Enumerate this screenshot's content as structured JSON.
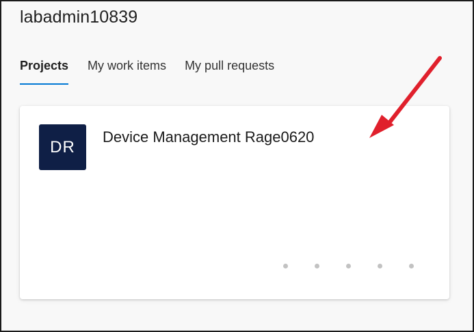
{
  "header": {
    "username": "labadmin10839"
  },
  "tabs": [
    {
      "label": "Projects",
      "selected": true
    },
    {
      "label": "My work items",
      "selected": false
    },
    {
      "label": "My pull requests",
      "selected": false
    }
  ],
  "project_card": {
    "avatar_initials": "DR",
    "name": "Device Management Rage0620",
    "pager_dots": 5
  },
  "colors": {
    "accent": "#0078d4",
    "avatar_bg": "#0f1f46",
    "annotation_arrow": "#e0202c",
    "dot": "#c2c2c2"
  },
  "icons": {
    "annotation": "red-arrow-icon"
  }
}
